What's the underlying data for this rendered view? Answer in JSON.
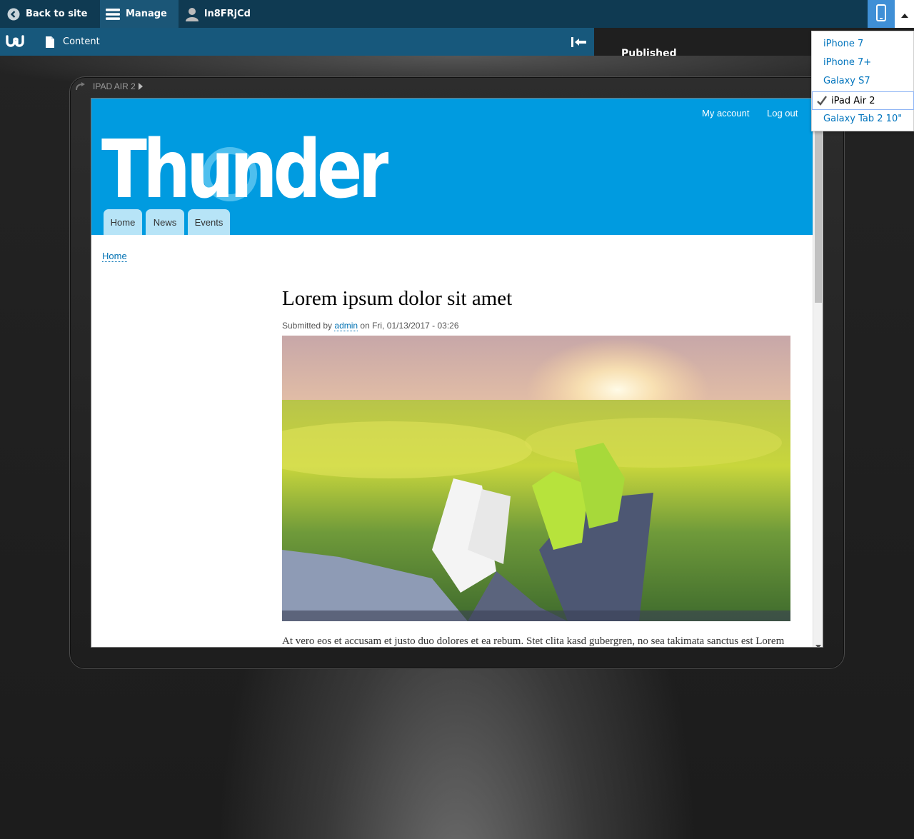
{
  "toolbar": {
    "back_label": "Back to site",
    "manage_label": "Manage",
    "user_label": "ln8FRjCd",
    "tray_content_label": "Content",
    "published_label": "Published"
  },
  "device_preview": {
    "current_device_label": "IPAD AIR 2",
    "devices": [
      {
        "label": "iPhone 7",
        "selected": false
      },
      {
        "label": "iPhone 7+",
        "selected": false
      },
      {
        "label": "Galaxy S7",
        "selected": false
      },
      {
        "label": "iPad Air 2",
        "selected": true
      },
      {
        "label": "Galaxy Tab 2 10\"",
        "selected": false
      }
    ]
  },
  "site": {
    "secondary_links": [
      "My account",
      "Log out"
    ],
    "logo_text": "Thunder",
    "nav": [
      "Home",
      "News",
      "Events"
    ],
    "breadcrumb": "Home"
  },
  "article": {
    "title": "Lorem ipsum dolor sit amet",
    "submitted_prefix": "Submitted by",
    "author": "admin",
    "submitted_suffix": "on Fri, 01/13/2017 - 03:26",
    "body_text": "At vero eos et accusam et justo duo dolores et ea rebum. Stet clita kasd gubergren, no sea takimata sanctus est Lorem"
  },
  "colors": {
    "toolbar_bg": "#0f3a52",
    "tray_bg": "#17587c",
    "site_header_bg": "#009be0",
    "link": "#0071b3"
  }
}
